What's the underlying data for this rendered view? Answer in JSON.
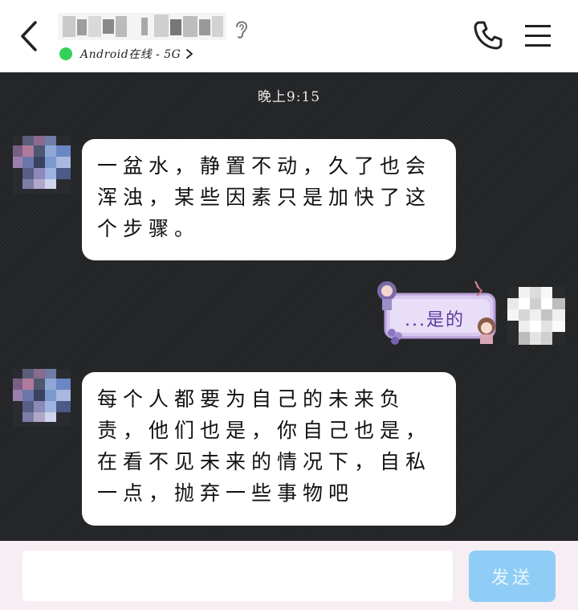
{
  "header": {
    "status_text": "Android在线 - 5G",
    "back_icon": "chevron-left-icon",
    "ear_icon": "ear-icon",
    "phone_icon": "phone-icon",
    "menu_icon": "hamburger-menu-icon",
    "online_color": "#35d05a"
  },
  "chat": {
    "timestamp": "晚上9:15",
    "messages": [
      {
        "side": "left",
        "text": "一盆水，静置不动，久了也会浑浊，某些因素只是加快了这个步骤。"
      },
      {
        "side": "right",
        "type": "sticker",
        "text": "...是的"
      },
      {
        "side": "left",
        "text": "每个人都要为自己的未来负责，他们也是，你自己也是，在看不见未来的情况下，自私一点，抛弃一些事物吧"
      }
    ]
  },
  "composer": {
    "input_value": "",
    "send_label": "发送",
    "send_color": "#8fcdf6"
  }
}
